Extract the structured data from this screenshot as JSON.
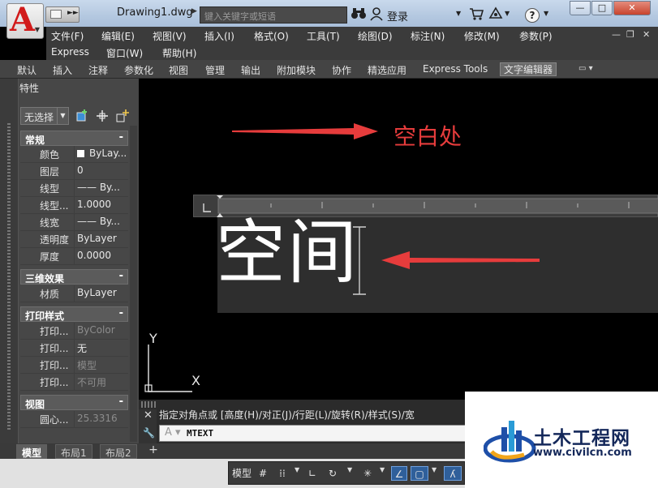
{
  "titlebar": {
    "doc_title": "Drawing1.dwg",
    "search_placeholder": "键入关键字或短语",
    "login_label": "登录",
    "app_button_letter": "A"
  },
  "menubar": {
    "items": [
      "文件(F)",
      "编辑(E)",
      "视图(V)",
      "插入(I)",
      "格式(O)",
      "工具(T)",
      "绘图(D)",
      "标注(N)",
      "修改(M)",
      "参数(P)",
      "Express",
      "窗口(W)",
      "帮助(H)"
    ]
  },
  "ribbon": {
    "tabs": [
      "默认",
      "插入",
      "注释",
      "参数化",
      "视图",
      "管理",
      "输出",
      "附加模块",
      "协作",
      "精选应用",
      "Express Tools",
      "文字编辑器"
    ],
    "active_tab": "文字编辑器"
  },
  "properties": {
    "title": "特性",
    "selection": "无选择",
    "sections": [
      {
        "title": "常规",
        "toggle": "-",
        "rows": [
          {
            "label": "颜色",
            "value": "ByLay..."
          },
          {
            "label": "图层",
            "value": "0"
          },
          {
            "label": "线型",
            "value": "—— By..."
          },
          {
            "label": "线型...",
            "value": "1.0000"
          },
          {
            "label": "线宽",
            "value": "—— By..."
          },
          {
            "label": "透明度",
            "value": "ByLayer"
          },
          {
            "label": "厚度",
            "value": "0.0000"
          }
        ]
      },
      {
        "title": "三维效果",
        "toggle": "-",
        "rows": [
          {
            "label": "材质",
            "value": "ByLayer"
          }
        ]
      },
      {
        "title": "打印样式",
        "toggle": "-",
        "rows": [
          {
            "label": "打印...",
            "value": "ByColor",
            "dim": true
          },
          {
            "label": "打印...",
            "value": "无"
          },
          {
            "label": "打印...",
            "value": "模型",
            "dim": true
          },
          {
            "label": "打印...",
            "value": "不可用",
            "dim": true
          }
        ]
      },
      {
        "title": "视图",
        "toggle": "-",
        "rows": [
          {
            "label": "圆心...",
            "value": "25.3316",
            "dim": true
          }
        ]
      }
    ]
  },
  "canvas": {
    "annotation_text": "空白处",
    "annotation_color": "#e63c3c",
    "mtext_content": "空间",
    "ucs_x_label": "X",
    "ucs_y_label": "Y"
  },
  "command": {
    "history": "指定对角点或 [高度(H)/对正(J)/行距(L)/旋转(R)/样式(S)/宽",
    "input_value": "MTEXT"
  },
  "layout_tabs": [
    "模型",
    "布局1",
    "布局2"
  ],
  "statusbar": {
    "model_label": "模型"
  },
  "watermark": {
    "name": "土木工程网",
    "url": "www.civilcn.com"
  }
}
